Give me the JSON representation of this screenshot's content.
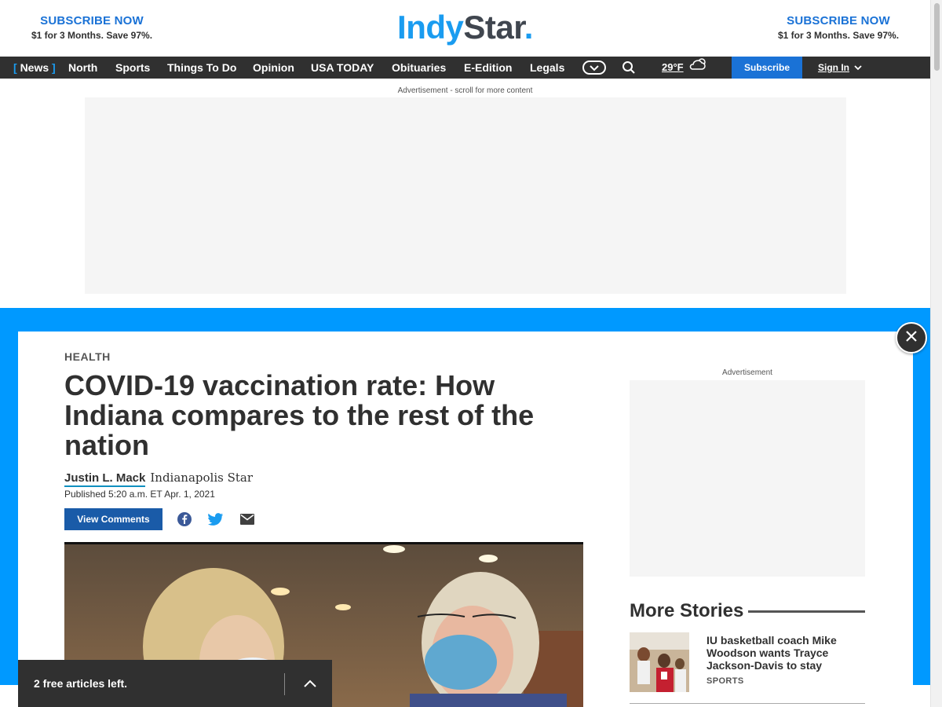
{
  "masthead": {
    "promo_left": {
      "title": "SUBSCRIBE NOW",
      "subtitle": "$1 for 3 Months. Save 97%."
    },
    "promo_right": {
      "title": "SUBSCRIBE NOW",
      "subtitle": "$1 for 3 Months. Save 97%."
    },
    "logo": {
      "part1": "Indy",
      "part2": "Star",
      "part3": "."
    }
  },
  "nav": {
    "items": [
      {
        "label": "News",
        "active": true
      },
      {
        "label": "North"
      },
      {
        "label": "Sports"
      },
      {
        "label": "Things To Do"
      },
      {
        "label": "Opinion"
      },
      {
        "label": "USA TODAY"
      },
      {
        "label": "Obituaries"
      },
      {
        "label": "E-Edition"
      },
      {
        "label": "Legals"
      }
    ],
    "bracket_open": "[",
    "bracket_close": "]",
    "weather_temp": "29°F",
    "subscribe_label": "Subscribe",
    "signin_label": "Sign In",
    "icons": [
      "more-menu-icon",
      "search-icon",
      "weather-cloud-icon",
      "chevron-down-icon"
    ]
  },
  "ad": {
    "top_label": "Advertisement - scroll for more content",
    "rail_label": "Advertisement"
  },
  "article": {
    "section": "HEALTH",
    "headline": "COVID-19 vaccination rate: How Indiana compares to the rest of the nation",
    "author": "Justin L. Mack",
    "organization": "Indianapolis Star",
    "published": "Published 5:20 a.m. ET Apr. 1, 2021",
    "view_comments": "View Comments",
    "share_icons": [
      "facebook-icon",
      "twitter-icon",
      "email-icon"
    ]
  },
  "more_stories": {
    "title": "More Stories",
    "items": [
      {
        "headline": "IU basketball coach Mike Woodson wants Trayce Jackson-Davis to stay",
        "section": "SPORTS"
      }
    ]
  },
  "meter": {
    "text": "2 free articles left."
  },
  "colors": {
    "brand_blue": "#1a9cf0",
    "overlay_blue": "#0099ff",
    "nav_bg": "#303030",
    "subscribe_blue": "#1a72d6"
  }
}
